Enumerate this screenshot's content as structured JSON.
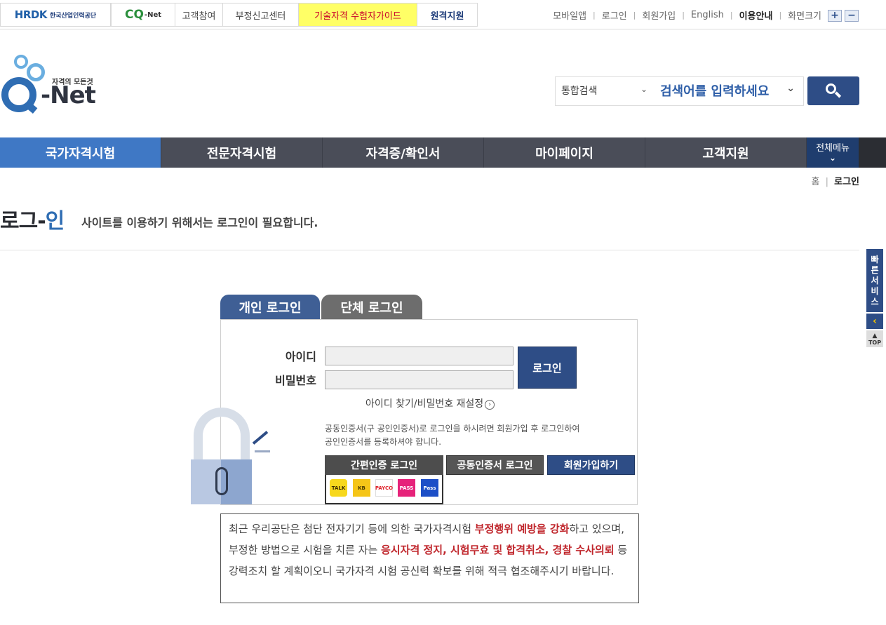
{
  "topbar": {
    "hrdk_logo": "HRDK",
    "hrdk_name": "한국산업인력공단",
    "cqnet_logo": "CQ",
    "cqnet_suffix": "-Net",
    "links": [
      "고객참여",
      "부정신고센터",
      "기술자격 수험자가이드",
      "원격지원"
    ],
    "util": [
      "모바일앱",
      "로그인",
      "회원가입",
      "English",
      "이용안내",
      "화면크기"
    ],
    "zoom_in": "+",
    "zoom_out": "−"
  },
  "header": {
    "logo_slogan": "자격의 모든것",
    "logo_text": "-Net",
    "search_scope": "통합검색",
    "search_placeholder": "검색어를 입력하세요"
  },
  "nav": {
    "items": [
      "국가자격시험",
      "전문자격시험",
      "자격증/확인서",
      "마이페이지",
      "고객지원"
    ],
    "all_menu": "전체메뉴"
  },
  "breadcrumb": {
    "home": "홈",
    "current": "로그인"
  },
  "page": {
    "title_a": "로그-",
    "title_b": "인",
    "description": "사이트를 이용하기 위해서는 로그인이 필요합니다."
  },
  "quick": {
    "label": "빠른서비스",
    "collapse": "‹",
    "top": "TOP"
  },
  "login": {
    "tabs": [
      "개인 로그인",
      "단체 로그인"
    ],
    "id_label": "아이디",
    "pw_label": "비밀번호",
    "login_button": "로그인",
    "find_link": "아이디 찾기/비밀번호 재설정",
    "notice_line1": "공동인증서(구 공인인증서)로 로그인을 하시려면 회원가입 후 로그인하여",
    "notice_line2": "공인인증서를 등록하셔야 합니다.",
    "easy_auth_button": "간편인증 로그인",
    "cert_button": "공동인증서 로그인",
    "join_button": "회원가입하기",
    "providers": [
      "TALK",
      "KB",
      "PAYCO",
      "PASS",
      "Pass"
    ]
  },
  "warning": {
    "p1": "최근 우리공단은 첨단 전자기기 등에 의한 국가자격시험 ",
    "r1": "부정행위 예방을 강화",
    "p2": "하고 있으며, 부정한 방법으로 시험을 치른 자는 ",
    "r2": "응시자격 정지, 시험무효 및 합격취소, 경찰 수사의뢰",
    "p3": " 등 강력조치 할 계획이오니 국가자격 시험 공신력 확보를 위해 적극 협조해주시기 바랍니다."
  },
  "colors": {
    "brand": "#2e4d86",
    "nav_active": "#3f78c5",
    "nav_bg": "#4a4d58",
    "warning_red": "#c0272d",
    "highlight": "#ffff66"
  }
}
